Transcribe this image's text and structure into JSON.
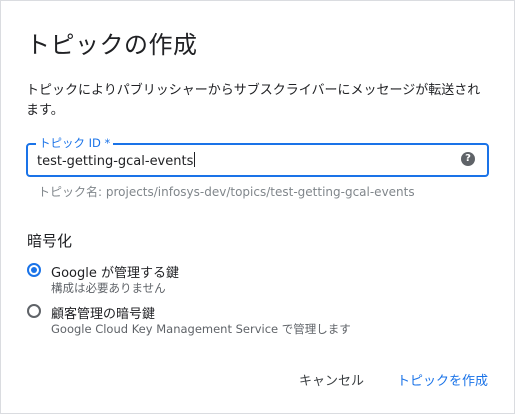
{
  "dialog": {
    "title": "トピックの作成",
    "description": "トピックによりパブリッシャーからサブスクライバーにメッセージが転送されます。"
  },
  "topic_field": {
    "label": "トピック ID *",
    "value": "test-getting-gcal-events",
    "help_icon": "help-circle-icon",
    "hint": "トピック名: projects/infosys-dev/topics/test-getting-gcal-events"
  },
  "encryption": {
    "title": "暗号化",
    "options": [
      {
        "label": "Google が管理する鍵",
        "sublabel": "構成は必要ありません",
        "selected": true
      },
      {
        "label": "顧客管理の暗号鍵",
        "sublabel": "Google Cloud Key Management Service で管理します",
        "selected": false
      }
    ]
  },
  "actions": {
    "cancel_label": "キャンセル",
    "create_label": "トピックを作成"
  },
  "colors": {
    "accent": "#1a73e8",
    "text": "#202124",
    "muted": "#80868b"
  }
}
